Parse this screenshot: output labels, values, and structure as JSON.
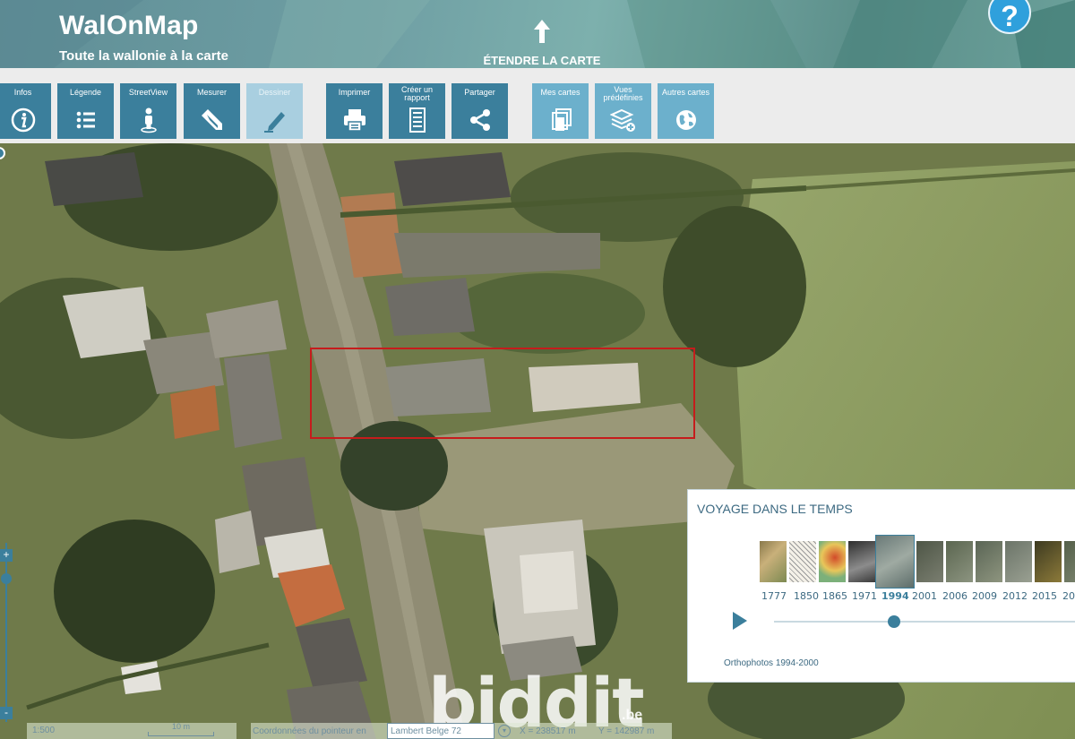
{
  "header": {
    "title": "WalOnMap",
    "subtitle": "Toute la wallonie à la carte",
    "expand_label": "ÉTENDRE LA CARTE",
    "help_label": "?"
  },
  "toolbar": {
    "groups": [
      [
        {
          "label": "Infos",
          "icon": "info-icon"
        },
        {
          "label": "Légende",
          "icon": "legend-list-icon"
        },
        {
          "label": "StreetView",
          "icon": "streetview-person-icon"
        },
        {
          "label": "Mesurer",
          "icon": "ruler-icon"
        },
        {
          "label": "Dessiner",
          "icon": "pencil-icon",
          "disabled": true
        }
      ],
      [
        {
          "label": "Imprimer",
          "icon": "printer-icon"
        },
        {
          "label": "Créer un rapport",
          "icon": "report-icon"
        },
        {
          "label": "Partager",
          "icon": "share-icon"
        }
      ],
      [
        {
          "label": "Mes cartes",
          "icon": "my-maps-icon"
        },
        {
          "label": "Vues prédéfinies",
          "icon": "layers-add-icon"
        },
        {
          "label": "Autres cartes",
          "icon": "globe-icon"
        }
      ]
    ]
  },
  "time_travel": {
    "title": "VOYAGE DANS LE TEMPS",
    "years": [
      "1777",
      "1850",
      "1865",
      "1971",
      "1994",
      "2001",
      "2006",
      "2009",
      "2012",
      "2015",
      "20"
    ],
    "selected_year": "1994",
    "caption": "Orthophotos 1994-2000"
  },
  "status": {
    "scale": "1:500",
    "scale_bar_label": "10 m",
    "coords_label": "Coordonnées du pointeur en",
    "projection": "Lambert Belge 72",
    "x": "X = 238517 m",
    "y": "Y = 142987 m"
  },
  "map_controls": {
    "zoom_in": "+",
    "zoom_out": "-"
  },
  "watermark": {
    "brand": "biddit",
    "tld": ".be"
  },
  "colors": {
    "accent": "#3b7f9c",
    "disabled": "#a9cfe0",
    "parcel_outline": "#c61c1c",
    "help": "#2fa0dc"
  }
}
